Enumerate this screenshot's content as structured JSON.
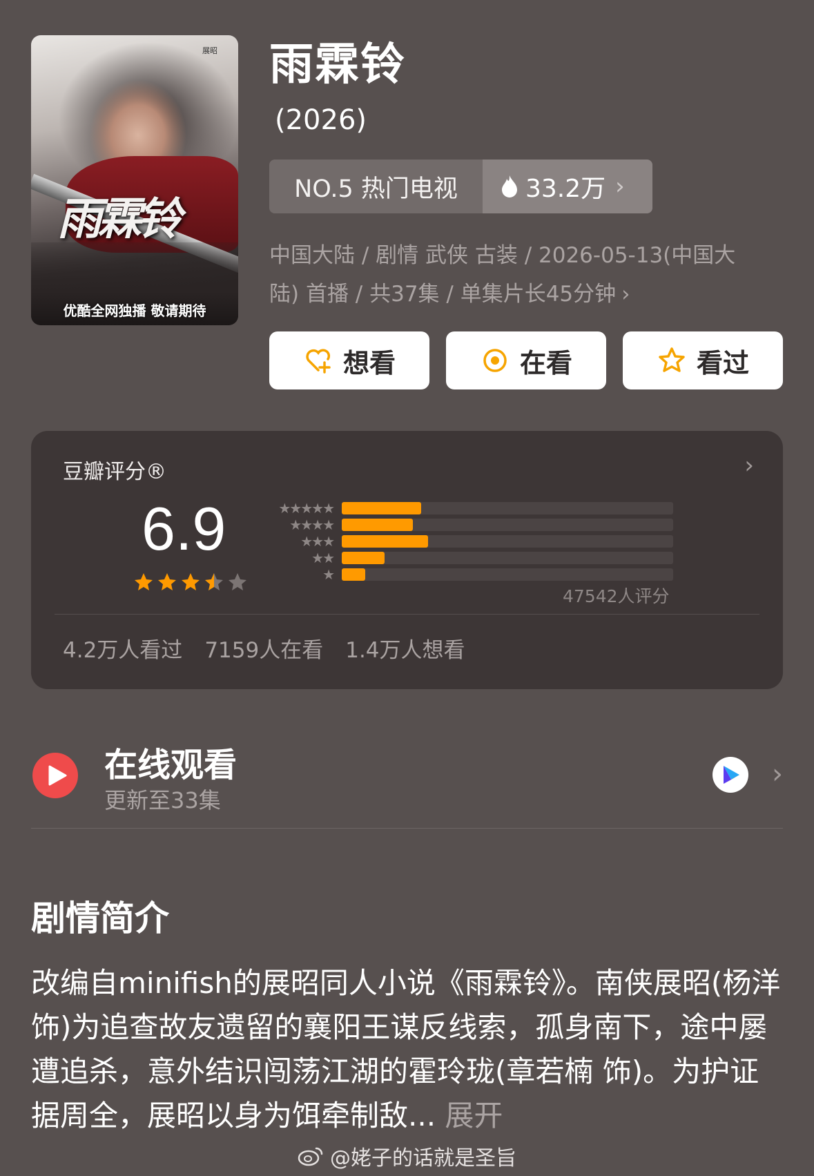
{
  "poster": {
    "calligraphy": "雨霖铃",
    "name_tag": "展昭",
    "tagline": "优酷全网独播 敬请期待"
  },
  "title": "雨霖铃",
  "year": "(2026)",
  "rank": {
    "label": "NO.5 热门电视",
    "heat": "33.2万"
  },
  "meta": {
    "line1": "中国大陆 / 剧情 武侠 古装 / 2026-05-13(中国大",
    "line2": "陆) 首播 / 共37集 / 单集片长45分钟"
  },
  "actions": {
    "want": "想看",
    "watching": "在看",
    "watched": "看过"
  },
  "rating": {
    "label": "豆瓣评分®",
    "score": "6.9",
    "stars": 3.5,
    "distribution_fraction": [
      0.24,
      0.215,
      0.26,
      0.13,
      0.07
    ],
    "raters": "47542人评分",
    "watched_count": "4.2万人看过",
    "watching_count": "7159人在看",
    "want_count": "1.4万人想看"
  },
  "watch": {
    "title": "在线观看",
    "subtitle": "更新至33集"
  },
  "synopsis": {
    "title": "剧情简介",
    "text": "改编自minifish的展昭同人小说《雨霖铃》。南侠展昭(杨洋 饰)为追查故友遗留的襄阳王谋反线索，孤身南下，途中屡遭追杀，意外结识闯荡江湖的霍玲珑(章若楠 饰)。为护证据周全，展昭以身为饵牵制敌...",
    "more": "展开"
  },
  "watermark": "@姥子的话就是圣旨",
  "colors": {
    "background": "#57504f",
    "card": "#3d3636",
    "accent": "#ff9a00",
    "play": "#ef4b4b"
  }
}
